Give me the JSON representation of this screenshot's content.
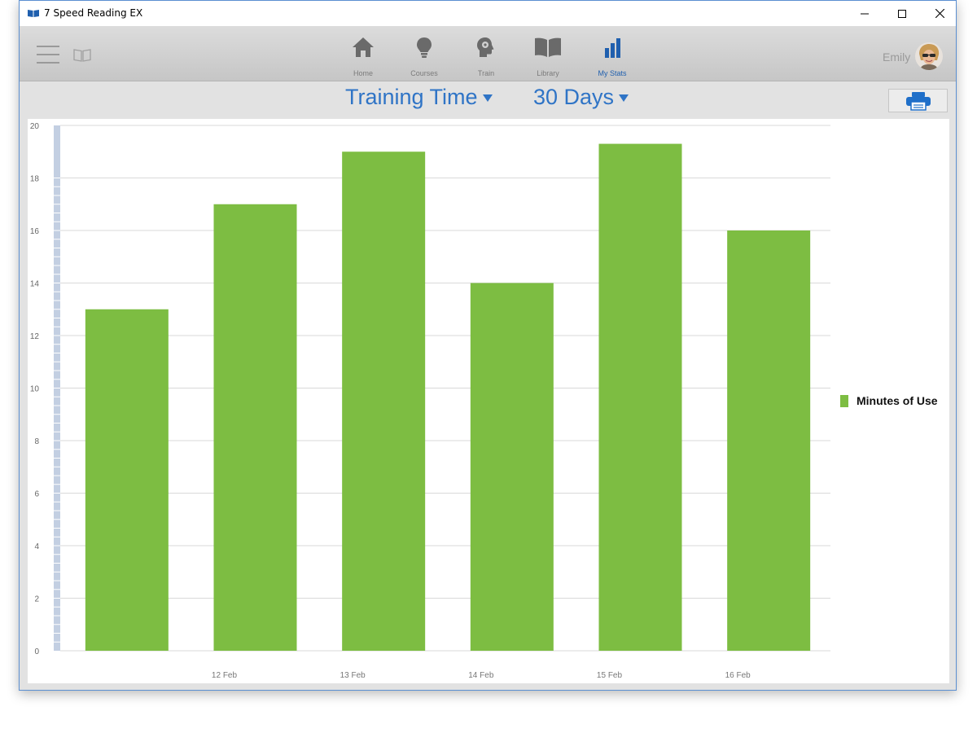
{
  "window": {
    "title": "7 Speed Reading EX"
  },
  "nav": {
    "items": [
      {
        "label": "Home",
        "icon": "home-icon"
      },
      {
        "label": "Courses",
        "icon": "lightbulb-icon"
      },
      {
        "label": "Train",
        "icon": "brain-gear-icon"
      },
      {
        "label": "Library",
        "icon": "open-book-icon"
      },
      {
        "label": "My Stats",
        "icon": "bar-chart-icon",
        "active": true
      }
    ],
    "active_color": "#1f5fae"
  },
  "user": {
    "name": "Emily"
  },
  "filters": {
    "metric": "Training Time",
    "range": "30 Days"
  },
  "chart_data": {
    "type": "bar",
    "categories": [
      "",
      "12 Feb",
      "13 Feb",
      "14 Feb",
      "15 Feb",
      "16 Feb"
    ],
    "series": [
      {
        "name": "Minutes of Use",
        "values": [
          13,
          17,
          19,
          14,
          19.3,
          16
        ],
        "color": "#7dbd42"
      }
    ],
    "ylim": [
      0,
      20
    ],
    "yticks": [
      0,
      2,
      4,
      6,
      8,
      10,
      12,
      14,
      16,
      18,
      20
    ],
    "grid": true,
    "legend": "right"
  }
}
